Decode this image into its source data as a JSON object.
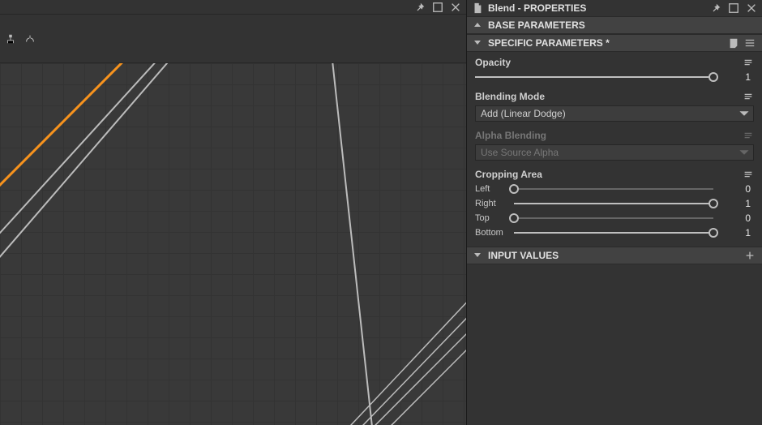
{
  "panel": {
    "title": "Blend - PROPERTIES"
  },
  "sections": {
    "base": {
      "label": "BASE PARAMETERS"
    },
    "specific": {
      "label": "SPECIFIC PARAMETERS *"
    },
    "input": {
      "label": "INPUT VALUES"
    }
  },
  "params": {
    "opacity": {
      "label": "Opacity",
      "value": "1",
      "fill": 1.0
    },
    "blending_mode": {
      "label": "Blending Mode",
      "value": "Add (Linear Dodge)"
    },
    "alpha_blending": {
      "label": "Alpha Blending",
      "value": "Use Source Alpha"
    },
    "cropping": {
      "label": "Cropping Area",
      "left": {
        "label": "Left",
        "value": "0",
        "fill": 0.0
      },
      "right": {
        "label": "Right",
        "value": "1",
        "fill": 1.0
      },
      "top": {
        "label": "Top",
        "value": "0",
        "fill": 0.0
      },
      "bottom": {
        "label": "Bottom",
        "value": "1",
        "fill": 1.0
      }
    }
  }
}
